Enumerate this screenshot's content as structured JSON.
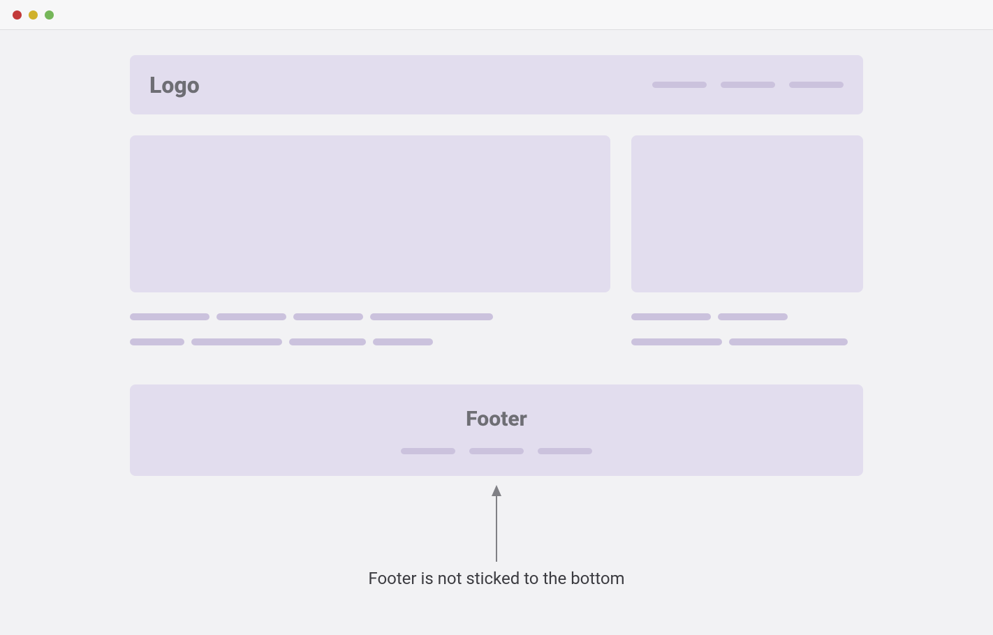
{
  "header": {
    "logo_label": "Logo",
    "nav_bar_count": 3
  },
  "main": {
    "left_lines": [
      [
        114,
        100,
        100,
        176
      ],
      [
        78,
        130,
        110,
        86
      ]
    ],
    "right_lines": [
      [
        114,
        100
      ],
      [
        130,
        170
      ]
    ]
  },
  "footer": {
    "title": "Footer",
    "link_bar_count": 3
  },
  "annotation": {
    "caption": "Footer is not sticked to the bottom"
  },
  "colors": {
    "panel_bg": "#e2ddee",
    "bar": "#cbc2dd",
    "page_bg": "#f2f2f4",
    "text": "#6e6e74"
  }
}
